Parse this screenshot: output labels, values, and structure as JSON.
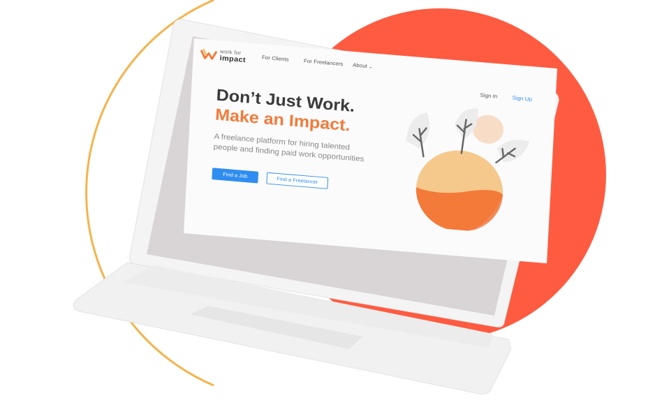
{
  "brand": {
    "logo_line1": "work for",
    "logo_line2": "impact",
    "accent_color": "#f47a3a",
    "primary_color": "#2f8df1",
    "background_circle_color": "#ff5b41",
    "ring_color": "#f5b34a"
  },
  "nav": {
    "for_clients": "For Clients",
    "for_freelancers": "For Freelancers",
    "about": "About",
    "about_icon": "chevron-down-icon",
    "sign_in": "Sign In",
    "sign_up": "Sign Up"
  },
  "hero": {
    "headline_line1": "Don’t Just Work.",
    "headline_line2": "Make an Impact.",
    "subtitle": "A freelance platform for hiring talented people and finding paid work opportunities",
    "find_job_button": "Find a Job",
    "find_freelancer_button": "Find a Freelancer"
  }
}
